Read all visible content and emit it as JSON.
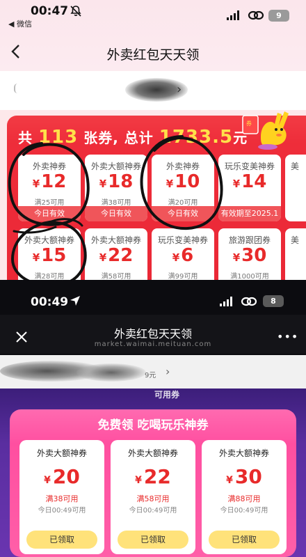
{
  "top": {
    "status": {
      "time": "00:47",
      "back_app": "◀ 微信",
      "battery": "9"
    },
    "title": "外卖红包天天领",
    "summary": {
      "prefix": "共",
      "count": "113",
      "middle": "张券, 总计",
      "total": "1733.5",
      "suffix": "元"
    },
    "coupons": [
      {
        "title": "外卖神券",
        "amount": "12",
        "min": "满25可用",
        "footer": "今日有效"
      },
      {
        "title": "外卖大额神券",
        "amount": "18",
        "min": "满38可用",
        "footer": "今日有效"
      },
      {
        "title": "外卖神券",
        "amount": "10",
        "min": "满20可用",
        "footer": "今日有效"
      },
      {
        "title": "玩乐变美神券",
        "amount": "14",
        "min": "",
        "footer": "有效期至2025.1"
      },
      {
        "title": "美",
        "amount": "",
        "min": "",
        "footer": ""
      },
      {
        "title": "外卖大额神券",
        "amount": "15",
        "min": "满28可用",
        "footer": ""
      },
      {
        "title": "外卖大额神券",
        "amount": "22",
        "min": "满58可用",
        "footer": ""
      },
      {
        "title": "玩乐变美神券",
        "amount": "6",
        "min": "满99可用",
        "footer": ""
      },
      {
        "title": "旅游跟团券",
        "amount": "30",
        "min": "满1000可用",
        "footer": ""
      },
      {
        "title": "美",
        "amount": "",
        "min": "",
        "footer": ""
      }
    ]
  },
  "bottom": {
    "status": {
      "time": "00:49",
      "battery": "8"
    },
    "title": "外卖红包天天领",
    "url": "market.waimai.meituan.com",
    "more": "•••",
    "fragment_yuan": "9元",
    "fragment_banner": "可用券",
    "section_title": "免费领 吃喝玩乐神券",
    "cards": [
      {
        "title": "外卖大额神券",
        "amount": "20",
        "min": "满38可用",
        "date": "今日00:49可用",
        "button": "已领取"
      },
      {
        "title": "外卖大额神券",
        "amount": "22",
        "min": "满58可用",
        "date": "今日00:49可用",
        "button": "已领取"
      },
      {
        "title": "外卖大额神券",
        "amount": "30",
        "min": "满88可用",
        "date": "今日00:49可用",
        "button": "已领取"
      }
    ]
  },
  "currency_symbol": "¥",
  "colors": {
    "coupon_red": "#e82a2a",
    "panel_red": "#ee2d3a",
    "pink": "#ff4fa0",
    "highlight_yellow": "#ffe14a"
  }
}
